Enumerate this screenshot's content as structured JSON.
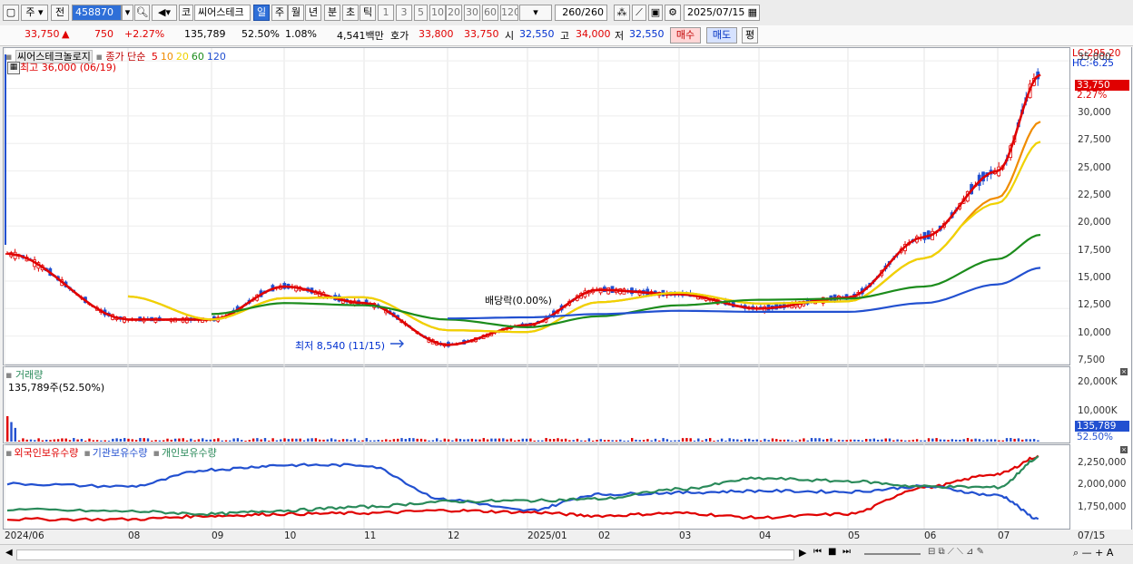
{
  "toolbar": {
    "period": "주",
    "prev": "전",
    "code": "458870",
    "type_icon": "코",
    "stock_name": "씨어스테크",
    "intervals": [
      "일",
      "주",
      "월",
      "년",
      "분",
      "초",
      "틱"
    ],
    "selected_interval": "일",
    "minute_buttons": [
      "1",
      "3",
      "5",
      "10",
      "20",
      "30",
      "60",
      "120"
    ],
    "count": "260",
    "count_total": "/260",
    "date": "2025/07/15"
  },
  "status": {
    "price": "33,750",
    "arrow": "▲",
    "change": "750",
    "change_pct": "+2.27%",
    "volume": "135,789",
    "vol_ratio": "52.50%",
    "turnover_pct": "1.08%",
    "amount": "4,541백만",
    "quote_label": "호가",
    "ask": "33,800",
    "bid": "33,750",
    "open_label": "시",
    "open": "32,550",
    "high_label": "고",
    "high": "34,000",
    "low_label": "저",
    "low": "32,550",
    "buy": "매수",
    "sell": "매도",
    "avg": "평"
  },
  "price_panel": {
    "stock_label": "씨어스테크놀로지",
    "ma_title": "종가 단순",
    "ma_periods": [
      "5",
      "10",
      "20",
      "60",
      "120"
    ],
    "ma_colors": [
      "#e00000",
      "#f08c00",
      "#f0d200",
      "#1c8c1c",
      "#2250d0"
    ],
    "high_label": "최고 36,000 (06/19)",
    "low_label": "최저 8,540 (11/15)",
    "dividend_label": "배당락(0.00%)",
    "lc": "LC:295.20",
    "hc": "HC:-6.25",
    "current_tag": "33,750",
    "current_pct": "2.27%",
    "y_labels": [
      "35,000",
      "32,500",
      "30,000",
      "27,500",
      "25,000",
      "22,500",
      "20,000",
      "17,500",
      "15,000",
      "12,500",
      "10,000",
      "7,500"
    ]
  },
  "volume_panel": {
    "title": "거래량",
    "value_label": "135,789주(52.50%)",
    "y_labels": [
      "20,000K",
      "10,000K"
    ],
    "current_tag": "135,789",
    "current_pct": "52.50%"
  },
  "holding_panel": {
    "series": [
      {
        "name": "외국인보유수량",
        "color": "#e00000"
      },
      {
        "name": "기관보유수량",
        "color": "#2250d0"
      },
      {
        "name": "개인보유수량",
        "color": "#2a8a5a"
      }
    ],
    "y_labels": [
      "2,250,000",
      "2,000,000",
      "1,750,000"
    ]
  },
  "x_axis": [
    "2024/06",
    "08",
    "09",
    "10",
    "11",
    "12",
    "2025/01",
    "02",
    "03",
    "04",
    "05",
    "06",
    "07"
  ],
  "x_axis_right": "07/15",
  "chart_data": {
    "type": "line",
    "title": "",
    "ylim": [
      7500,
      36000
    ],
    "x": [
      "2024/06",
      "08",
      "09",
      "10",
      "11",
      "12",
      "2025/01",
      "02",
      "03",
      "04",
      "05",
      "06",
      "07",
      "07/15"
    ],
    "series": [
      {
        "name": "5",
        "values": [
          17500,
          11500,
          11500,
          14500,
          13000,
          9200,
          11000,
          14200,
          13800,
          12500,
          13500,
          19000,
          25000,
          33750
        ]
      },
      {
        "name": "60",
        "values": [
          null,
          null,
          12000,
          13000,
          12800,
          11500,
          10800,
          11800,
          12800,
          13300,
          13400,
          14500,
          17000,
          19200
        ]
      },
      {
        "name": "120",
        "values": [
          null,
          null,
          null,
          null,
          null,
          11600,
          11700,
          12000,
          12300,
          12200,
          12200,
          13000,
          14700,
          16200
        ]
      }
    ]
  }
}
